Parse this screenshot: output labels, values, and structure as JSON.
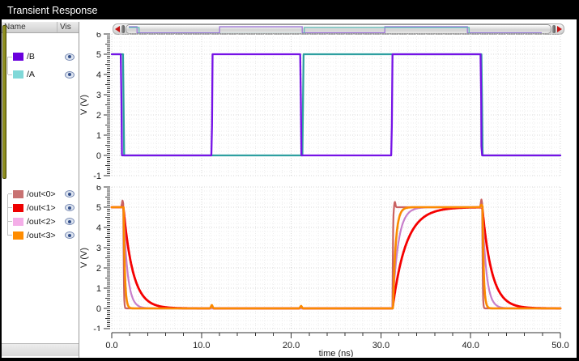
{
  "window": {
    "title": "Transient Response"
  },
  "tree": {
    "columns": [
      "Name",
      "Vis"
    ],
    "groups": [
      {
        "signals": [
          {
            "name": "/B",
            "swatch": "#6a00dd"
          },
          {
            "name": "/A",
            "swatch": "#80d8d8"
          }
        ]
      },
      {
        "signals": [
          {
            "name": "/out<0>",
            "swatch": "#c87272"
          },
          {
            "name": "/out<1>",
            "swatch": "#ee0000"
          },
          {
            "name": "/out<2>",
            "swatch": "#f4aee8"
          },
          {
            "name": "/out<3>",
            "swatch": "#ff8c00"
          }
        ]
      }
    ]
  },
  "chart_data": [
    {
      "type": "line",
      "strip": "top",
      "ylabel": "V (V)",
      "ylim": [
        -1,
        6
      ],
      "xlim": [
        0,
        50
      ],
      "grid": true,
      "series": [
        {
          "name": "/A",
          "color": "#2e9fa0",
          "points": [
            [
              0,
              5
            ],
            [
              1.25,
              5
            ],
            [
              1.33,
              2.2
            ],
            [
              1.38,
              0
            ],
            [
              21.25,
              0
            ],
            [
              21.32,
              2.8
            ],
            [
              21.38,
              5
            ],
            [
              41.2,
              5
            ],
            [
              41.28,
              2.2
            ],
            [
              41.34,
              0
            ],
            [
              50,
              0
            ]
          ]
        },
        {
          "name": "/B",
          "color": "#7612e6",
          "points": [
            [
              0,
              5
            ],
            [
              1.0,
              5
            ],
            [
              1.07,
              2.85
            ],
            [
              1.14,
              0
            ],
            [
              11.1,
              0
            ],
            [
              11.17,
              1.5
            ],
            [
              11.24,
              5
            ],
            [
              21.0,
              5
            ],
            [
              21.07,
              2.8
            ],
            [
              21.14,
              0
            ],
            [
              31.15,
              0
            ],
            [
              31.22,
              1.5
            ],
            [
              31.29,
              5
            ],
            [
              41.1,
              5
            ],
            [
              41.17,
              2.9
            ],
            [
              41.2,
              0.45
            ],
            [
              41.28,
              0
            ],
            [
              50,
              0
            ]
          ]
        }
      ]
    },
    {
      "type": "line",
      "strip": "bottom",
      "ylabel": "V (V)",
      "xlabel": "time (ns)",
      "ylim": [
        -1,
        6
      ],
      "xlim": [
        0,
        50
      ],
      "grid": true,
      "xticks": [
        "0.0",
        "10.0",
        "20.0",
        "30.0",
        "40.0",
        "50.0"
      ],
      "series": [
        {
          "name": "/out<0>",
          "color": "#c96262",
          "width": 2.2,
          "model": {
            "high": 5,
            "t_fall1": 1.3,
            "t_rise": 31.3,
            "t_fall2": 41.3,
            "tau_fall": 0.04,
            "tau_rise": 0.04,
            "spikes": [
              [
                1.2,
                0.33
              ],
              [
                31.55,
                0.27
              ],
              [
                41.2,
                0.38
              ]
            ]
          }
        },
        {
          "name": "/out<1>",
          "color": "#f50000",
          "width": 2.8,
          "model": {
            "high": 5,
            "t_fall1": 1.3,
            "t_rise": 31.3,
            "t_fall2": 41.3,
            "tau_fall": 1.05,
            "tau_rise": 1.5,
            "blips": [
              [
                11.15,
                0.1
              ],
              [
                21.1,
                0.08
              ]
            ]
          }
        },
        {
          "name": "/out<2>",
          "color": "#c77fcb",
          "width": 2.2,
          "model": {
            "high": 5,
            "t_fall1": 1.3,
            "t_rise": 31.3,
            "t_fall2": 41.3,
            "tau_fall": 0.45,
            "tau_rise": 0.62
          }
        },
        {
          "name": "/out<3>",
          "color": "#fb8a00",
          "width": 2.6,
          "model": {
            "high": 5,
            "t_fall1": 1.32,
            "t_rise": 31.35,
            "t_fall2": 41.32,
            "tau_fall": 0.14,
            "tau_rise": 0.3,
            "blips": [
              [
                11.15,
                0.16
              ],
              [
                21.1,
                0.12
              ],
              [
                41.2,
                0.12
              ]
            ]
          }
        }
      ]
    }
  ],
  "minimap": {
    "series": [
      {
        "name": "/B",
        "color": "#9a6fd8",
        "start": 1,
        "edges": [
          [
            1,
            0
          ],
          [
            11,
            1
          ],
          [
            21,
            0
          ],
          [
            31,
            1
          ],
          [
            41,
            0
          ]
        ]
      },
      {
        "name": "/A",
        "color": "#58b8b2",
        "start": 1,
        "edges": [
          [
            1.25,
            0
          ],
          [
            21.25,
            1
          ],
          [
            41.2,
            0
          ]
        ]
      }
    ]
  }
}
